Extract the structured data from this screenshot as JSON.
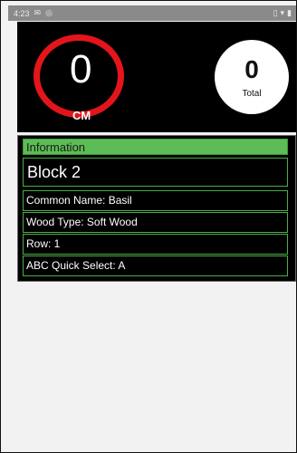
{
  "status_bar": {
    "time": "4:23",
    "left_icons": [
      "notification-icon",
      "data-saver-icon"
    ],
    "right_icons": [
      "vibrate-icon",
      "wifi-icon",
      "battery-icon"
    ]
  },
  "counter": {
    "value": "0",
    "label": "CM",
    "total_value": "0",
    "total_label": "Total",
    "ring_color": "#e3151b"
  },
  "information": {
    "header": "Information",
    "block": "Block 2",
    "common_name": "Common Name: Basil",
    "wood_type": "Wood Type: Soft Wood",
    "row": "Row: 1",
    "abc_quick_select": "ABC Quick Select: A",
    "accent_color": "#5cbc55"
  }
}
